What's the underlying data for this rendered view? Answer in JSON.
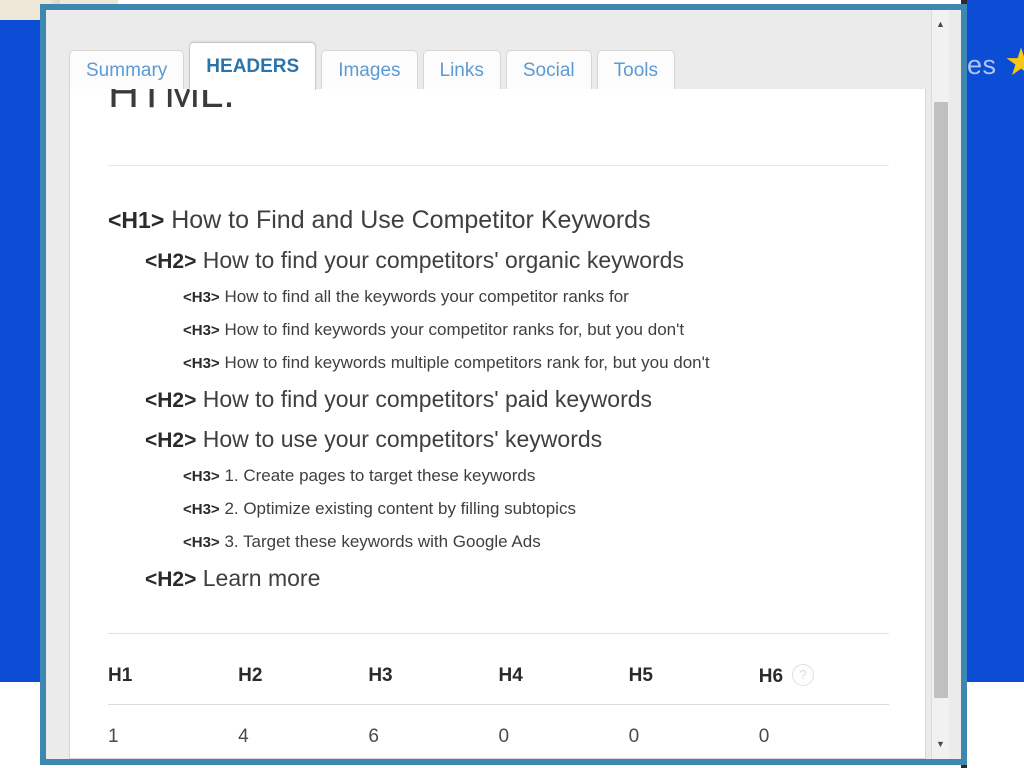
{
  "background": {
    "right_text": "es",
    "star_icon": "★",
    "blue_hex": "#0b4dd4",
    "cream_hex": "#ece7d7"
  },
  "modal": {
    "border_color": "#3d87b0",
    "tabs": [
      {
        "label": "Summary",
        "active": false
      },
      {
        "label": "HEADERS",
        "active": true
      },
      {
        "label": "Images",
        "active": false
      },
      {
        "label": "Links",
        "active": false
      },
      {
        "label": "Social",
        "active": false
      },
      {
        "label": "Tools",
        "active": false
      }
    ],
    "accent_color": "#2a74ab",
    "tab_link_color": "#5b9bd5"
  },
  "content": {
    "document_title_fragment": "HTML.",
    "headings": [
      {
        "tag": "<H1>",
        "level": 1,
        "text": "How to Find and Use Competitor Keywords"
      },
      {
        "tag": "<H2>",
        "level": 2,
        "text": "How to find your competitors' organic keywords"
      },
      {
        "tag": "<H3>",
        "level": 3,
        "text": "How to find all the keywords your competitor ranks for"
      },
      {
        "tag": "<H3>",
        "level": 3,
        "text": "How to find keywords your competitor ranks for, but you don't"
      },
      {
        "tag": "<H3>",
        "level": 3,
        "text": "How to find keywords multiple competitors rank for, but you don't"
      },
      {
        "tag": "<H2>",
        "level": 2,
        "text": "How to find your competitors' paid keywords"
      },
      {
        "tag": "<H2>",
        "level": 2,
        "text": "How to use your competitors' keywords"
      },
      {
        "tag": "<H3>",
        "level": 3,
        "text": "1. Create pages to target these keywords"
      },
      {
        "tag": "<H3>",
        "level": 3,
        "text": "2. Optimize existing content by filling subtopics"
      },
      {
        "tag": "<H3>",
        "level": 3,
        "text": "3. Target these keywords with Google Ads"
      },
      {
        "tag": "<H2>",
        "level": 2,
        "text": "Learn more"
      }
    ],
    "counts_table": {
      "columns": [
        "H1",
        "H2",
        "H3",
        "H4",
        "H5",
        "H6"
      ],
      "values": [
        "1",
        "4",
        "6",
        "0",
        "0",
        "0"
      ],
      "help_icon": "?"
    }
  },
  "scrollbar": {
    "up_arrow": "▲",
    "down_arrow": "▼"
  }
}
